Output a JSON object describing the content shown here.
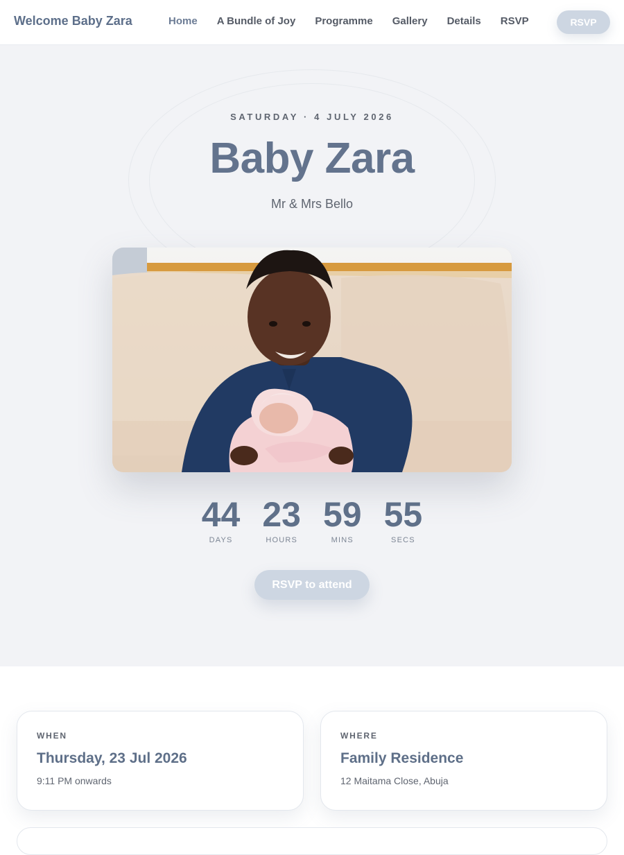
{
  "nav": {
    "brand": "Welcome Baby Zara",
    "links": [
      "Home",
      "A Bundle of Joy",
      "Programme",
      "Gallery",
      "Details",
      "RSVP"
    ],
    "rsvp_button": "RSVP"
  },
  "hero": {
    "date_line": "SATURDAY · 4 JULY 2026",
    "title": "Baby Zara",
    "subtitle": "Mr & Mrs Bello",
    "photo": "smiling-boy-holding-newborn-baby",
    "countdown": [
      {
        "value": "44",
        "label": "DAYS"
      },
      {
        "value": "23",
        "label": "HOURS"
      },
      {
        "value": "59",
        "label": "MINS"
      },
      {
        "value": "55",
        "label": "SECS"
      }
    ],
    "rsvp_button": "RSVP to attend"
  },
  "info": {
    "when": {
      "label": "WHEN",
      "title": "Thursday, 23 Jul 2026",
      "detail": "9:11 PM onwards"
    },
    "where": {
      "label": "WHERE",
      "title": "Family Residence",
      "detail": "12 Maitama Close, Abuja"
    }
  },
  "colors": {
    "accent": "#63738d",
    "button": "#cdd6e2",
    "hero_bg": "#f2f3f6"
  }
}
